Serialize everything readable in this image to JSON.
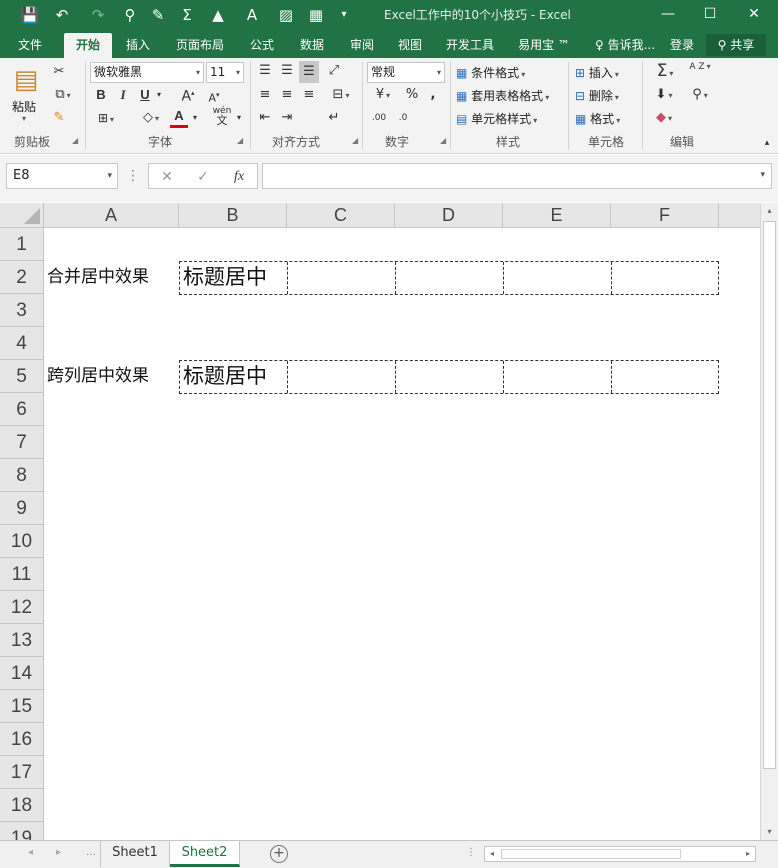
{
  "window": {
    "title": "Excel工作中的10个小技巧 - Excel",
    "minimize_glyph": "—",
    "restore_glyph": "☐",
    "close_glyph": "✕"
  },
  "quick_access": {
    "save_glyph": "💾",
    "undo_glyph": "↶",
    "redo_glyph": "↷",
    "user_add_glyph": "⚲",
    "brush_glyph": "✎",
    "sum_glyph": "Σ",
    "fill_glyph": "▲",
    "font_color_glyph": "A",
    "image_glyph": "▨",
    "chart_glyph": "▦",
    "more_glyph": "▾"
  },
  "tabs": [
    {
      "label": "文件"
    },
    {
      "label": "开始"
    },
    {
      "label": "插入"
    },
    {
      "label": "页面布局"
    },
    {
      "label": "公式"
    },
    {
      "label": "数据"
    },
    {
      "label": "审阅"
    },
    {
      "label": "视图"
    },
    {
      "label": "开发工具"
    },
    {
      "label": "易用宝 ™"
    }
  ],
  "tell_me": "告诉我...",
  "login": "登录",
  "share": "共享",
  "ribbon": {
    "clipboard": {
      "paste_label": "粘贴",
      "group_label": "剪贴板"
    },
    "font": {
      "font_name": "微软雅黑",
      "font_size": "11",
      "bold": "B",
      "italic": "I",
      "underline": "U",
      "grow": "A",
      "shrink": "A",
      "font_color": "A",
      "phonetic": "wén",
      "group_label": "字体"
    },
    "alignment": {
      "group_label": "对齐方式"
    },
    "number": {
      "format": "常规",
      "percent": "%",
      "comma": ",",
      "inc_decimal": ".00",
      "dec_decimal": ".0",
      "group_label": "数字"
    },
    "styles": {
      "conditional": "条件格式",
      "table_format": "套用表格格式",
      "cell_styles": "单元格样式",
      "group_label": "样式"
    },
    "cells": {
      "insert": "插入",
      "delete": "删除",
      "format": "格式",
      "group_label": "单元格"
    },
    "editing": {
      "sum": "Σ",
      "sort": "A Z",
      "group_label": "编辑"
    }
  },
  "formula_bar": {
    "name_box": "E8",
    "fx": "fx",
    "cancel": "✕",
    "enter": "✓",
    "value": ""
  },
  "grid": {
    "columns": [
      "A",
      "B",
      "C",
      "D",
      "E",
      "F"
    ],
    "rows": [
      "1",
      "2",
      "3",
      "4",
      "5",
      "6",
      "7",
      "8",
      "9",
      "10",
      "11",
      "12",
      "13",
      "14",
      "15",
      "16",
      "17",
      "18",
      "19"
    ],
    "cells": {
      "A2": "合并居中效果",
      "B2": "标题居中",
      "A5": "跨列居中效果",
      "B5": "标题居中"
    }
  },
  "sheets": [
    {
      "name": "Sheet1",
      "active": false
    },
    {
      "name": "Sheet2",
      "active": true
    }
  ],
  "colors": {
    "accent": "#217346"
  }
}
